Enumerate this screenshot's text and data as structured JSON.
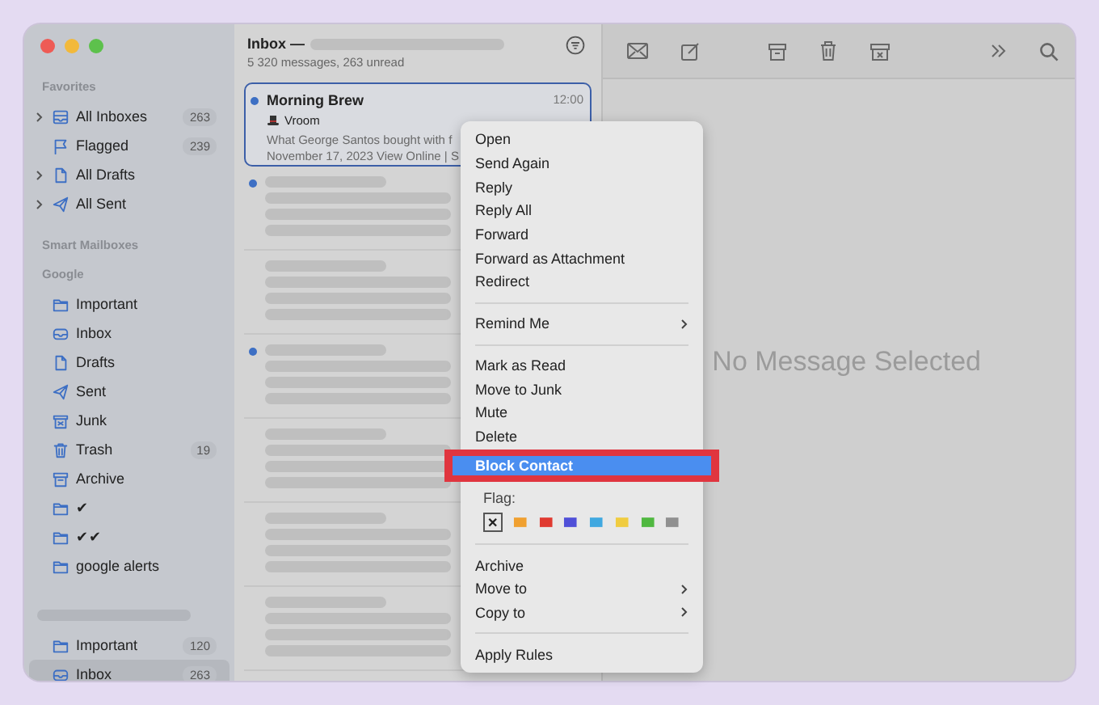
{
  "sidebar": {
    "sections": [
      {
        "title": "Favorites",
        "items": [
          {
            "label": "All Inboxes",
            "kind": "inboxes",
            "count": "263",
            "expandable": true,
            "selected": false
          },
          {
            "label": "Flagged",
            "kind": "flag",
            "count": "239",
            "expandable": false,
            "selected": false
          },
          {
            "label": "All Drafts",
            "kind": "draft",
            "expandable": true,
            "selected": false
          },
          {
            "label": "All Sent",
            "kind": "sent",
            "expandable": true,
            "selected": false
          }
        ]
      },
      {
        "title": "Smart Mailboxes"
      },
      {
        "title": "Google",
        "items": [
          {
            "label": "Important",
            "kind": "folder",
            "expandable": false,
            "selected": false
          },
          {
            "label": "Inbox",
            "kind": "inbox",
            "expandable": false,
            "selected": false
          },
          {
            "label": "Drafts",
            "kind": "draft",
            "expandable": false,
            "selected": false
          },
          {
            "label": "Sent",
            "kind": "sent",
            "expandable": false,
            "selected": false
          },
          {
            "label": "Junk",
            "kind": "junk",
            "expandable": false,
            "selected": false
          },
          {
            "label": "Trash",
            "kind": "trash",
            "count": "19",
            "expandable": false,
            "selected": false
          },
          {
            "label": "Archive",
            "kind": "archive",
            "expandable": false,
            "selected": false
          },
          {
            "label": "✔",
            "kind": "folder",
            "expandable": false,
            "selected": false
          },
          {
            "label": "✔✔",
            "kind": "folder",
            "expandable": false,
            "selected": false
          },
          {
            "label": "google alerts",
            "kind": "folder",
            "expandable": false,
            "selected": false
          }
        ]
      },
      {
        "items": [
          {
            "label": "Important",
            "kind": "folder",
            "count": "120",
            "expandable": false,
            "selected": false
          },
          {
            "label": "Inbox",
            "kind": "inbox",
            "count": "263",
            "expandable": false,
            "selected": true
          }
        ]
      }
    ]
  },
  "message_list": {
    "title": "Inbox —",
    "subtitle": "5 320 messages, 263 unread",
    "messages": [
      {
        "sender": "Morning Brew",
        "time": "12:00",
        "subject": "Vroom",
        "preview": [
          "What George Santos bought with f",
          "November 17, 2023 View Online | S"
        ],
        "unread": true,
        "selected": true
      },
      {
        "unread": true,
        "selected": false
      },
      {
        "unread": false,
        "selected": false
      },
      {
        "unread": true,
        "selected": false
      },
      {
        "unread": false,
        "selected": false
      },
      {
        "unread": false,
        "selected": false
      },
      {
        "unread": false,
        "selected": false
      }
    ]
  },
  "detail": {
    "empty_text": "No Message Selected"
  },
  "context_menu": {
    "items": [
      {
        "kind": "item",
        "label": "Open",
        "selected": false
      },
      {
        "kind": "item",
        "label": "Send Again",
        "selected": false
      },
      {
        "kind": "item",
        "label": "Reply",
        "selected": false
      },
      {
        "kind": "item",
        "label": "Reply All",
        "selected": false
      },
      {
        "kind": "item",
        "label": "Forward",
        "selected": false
      },
      {
        "kind": "item",
        "label": "Forward as Attachment",
        "selected": false
      },
      {
        "kind": "item",
        "label": "Redirect",
        "selected": false
      },
      {
        "kind": "separator"
      },
      {
        "kind": "submenu",
        "label": "Remind Me",
        "selected": false
      },
      {
        "kind": "separator"
      },
      {
        "kind": "item",
        "label": "Mark as Read",
        "selected": false
      },
      {
        "kind": "item",
        "label": "Move to Junk",
        "selected": false
      },
      {
        "kind": "item",
        "label": "Mute",
        "selected": false
      },
      {
        "kind": "item",
        "label": "Delete",
        "selected": false
      },
      {
        "kind": "item",
        "label": "Block Contact",
        "selected": true
      },
      {
        "kind": "flags",
        "label": "Flag:",
        "clear": "✕",
        "flags": [
          {
            "color": "#f0a030"
          },
          {
            "color": "#e03a30"
          },
          {
            "color": "#5050d8"
          },
          {
            "color": "#40a8e0"
          },
          {
            "color": "#f0cc40"
          },
          {
            "color": "#50b840"
          },
          {
            "color": "#909090"
          }
        ]
      },
      {
        "kind": "separator"
      },
      {
        "kind": "item",
        "label": "Archive",
        "selected": false
      },
      {
        "kind": "submenu",
        "label": "Move to",
        "selected": false
      },
      {
        "kind": "submenu",
        "label": "Copy to",
        "selected": false
      },
      {
        "kind": "separator"
      },
      {
        "kind": "item",
        "label": "Apply Rules",
        "selected": false
      }
    ]
  }
}
